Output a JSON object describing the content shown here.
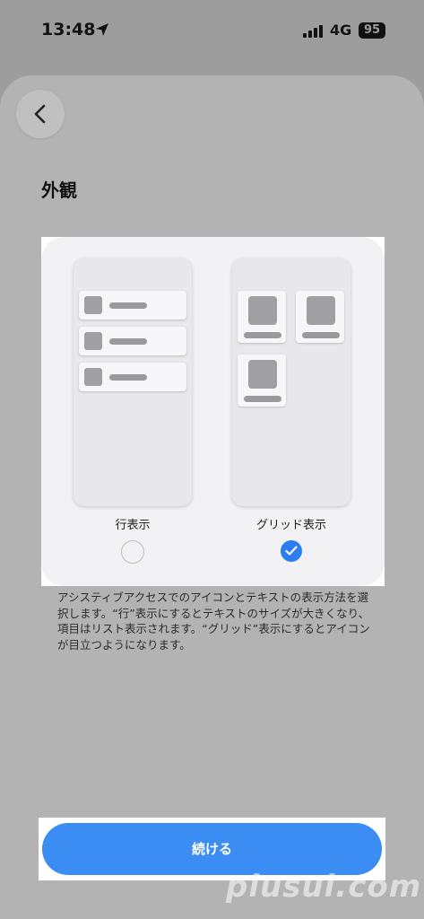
{
  "status_bar": {
    "time": "13:48",
    "location_icon": "location-arrow-icon",
    "signal_icon": "cellular-signal-icon",
    "network": "4G",
    "battery": "95"
  },
  "nav": {
    "back_icon": "chevron-left-icon"
  },
  "page": {
    "title": "外観"
  },
  "options": [
    {
      "label": "行表示",
      "selected": false
    },
    {
      "label": "グリッド表示",
      "selected": true
    }
  ],
  "description": "アシスティブアクセスでのアイコンとテキストの表示方法を選択します。“行”表示にするとテキストのサイズが大きくなり、項目はリスト表示されます。“グリッド”表示にするとアイコンが目立つようになります。",
  "continue_button": {
    "label": "続ける"
  },
  "watermark": "plusul.com",
  "colors": {
    "accent": "#3b8df4",
    "checked": "#2a7ef0",
    "overlay": "#9d9d9d"
  }
}
